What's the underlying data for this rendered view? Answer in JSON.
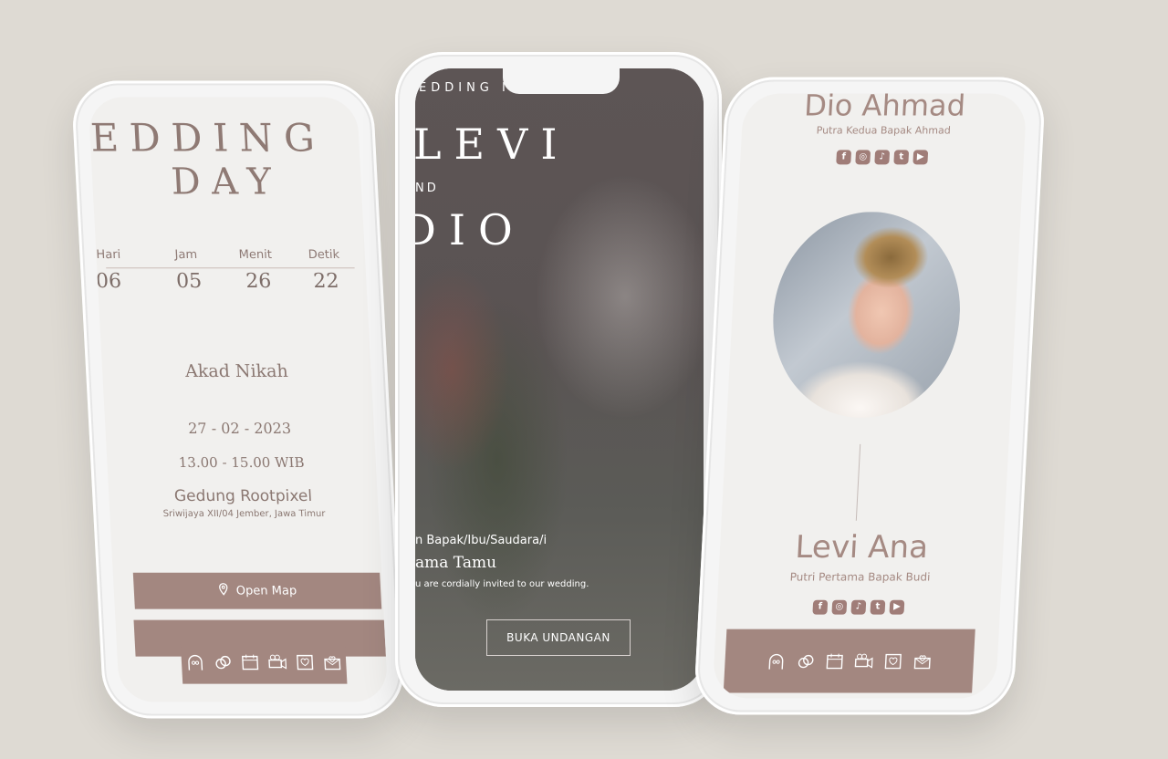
{
  "left_phone": {
    "title_line1": "EDDING",
    "title_line2": "DAY",
    "countdown": [
      {
        "label": "Hari",
        "value": "06"
      },
      {
        "label": "Jam",
        "value": "05"
      },
      {
        "label": "Menit",
        "value": "26"
      },
      {
        "label": "Detik",
        "value": "22"
      }
    ],
    "event_title": "Akad Nikah",
    "event_date": "27 - 02 - 2023",
    "event_time": "13.00 - 15.00 WIB",
    "venue": "Gedung Rootpixel",
    "address": "Sriwijaya XII/04 Jember, Jawa Timur",
    "map_button": "Open Map"
  },
  "middle_phone": {
    "kicker": "EDDING INVITATION",
    "name1": "LEVI",
    "and": "ND",
    "name2": "DIO",
    "to_label": "n Bapak/Ibu/Saudara/i",
    "guest": "ama Tamu",
    "invite_text": "u are cordially invited to our wedding.",
    "open_button": "BUKA UNDANGAN"
  },
  "right_phone": {
    "groom_name": "Dio Ahmad",
    "groom_parent": "Putra Kedua Bapak Ahmad",
    "bride_name": "Levi Ana",
    "bride_parent": "Putri Pertama Bapak Budi",
    "socials": [
      "facebook",
      "instagram",
      "tiktok",
      "twitter",
      "youtube"
    ]
  },
  "nav_icons": [
    "couple-arch-icon",
    "rings-icon",
    "calendar-icon",
    "camera-icon",
    "heart-frame-icon",
    "envelope-icon"
  ],
  "colors": {
    "accent": "#a38780",
    "background": "#dedad3",
    "text": "#8b7872"
  }
}
